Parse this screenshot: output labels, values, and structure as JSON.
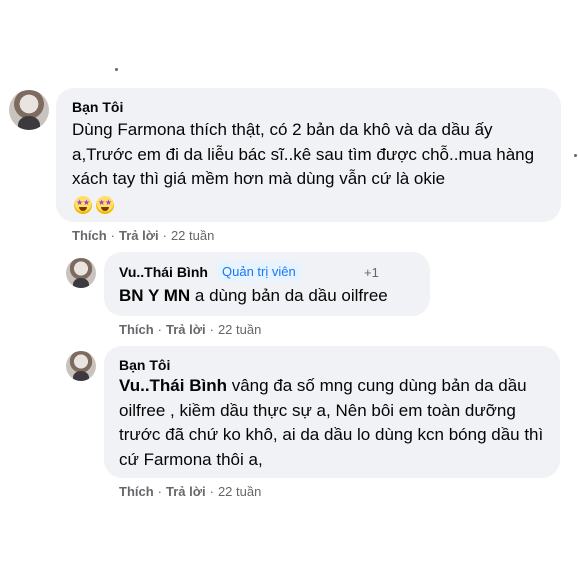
{
  "comment1": {
    "author": "Bạn Tôi",
    "text": "Dùng Farmona thích thật, có 2 bản da khô và da dầu ấy a,Trước em đi da liễu bác sĩ..kê sau tìm được chỗ..mua hàng xách tay thì giá mềm hơn mà dùng vẫn cứ là okie",
    "actions": {
      "like": "Thích",
      "reply": "Trả lời",
      "time": "22 tuần"
    },
    "emojis": [
      "star-struck",
      "star-struck"
    ]
  },
  "reply1": {
    "author": "Vu..Thái Bình",
    "badge": "Quản trị viên",
    "badge_extra": "+1",
    "mention": "BN Y MN",
    "text": " a dùng bản da dầu oilfree",
    "actions": {
      "like": "Thích",
      "reply": "Trả lời",
      "time": "22 tuần"
    }
  },
  "reply2": {
    "author": "Bạn Tôi",
    "mention": "Vu..Thái Bình",
    "text": " vâng đa số mng cung dùng bản da dầu oilfree , kiềm dầu thực sự a, Nên bôi em toàn dưỡng trước đã chứ ko khô, ai da dầu lo dùng kcn bóng dầu thì cứ Farmona thôi a,",
    "actions": {
      "like": "Thích",
      "reply": "Trả lời",
      "time": "22 tuần"
    }
  }
}
